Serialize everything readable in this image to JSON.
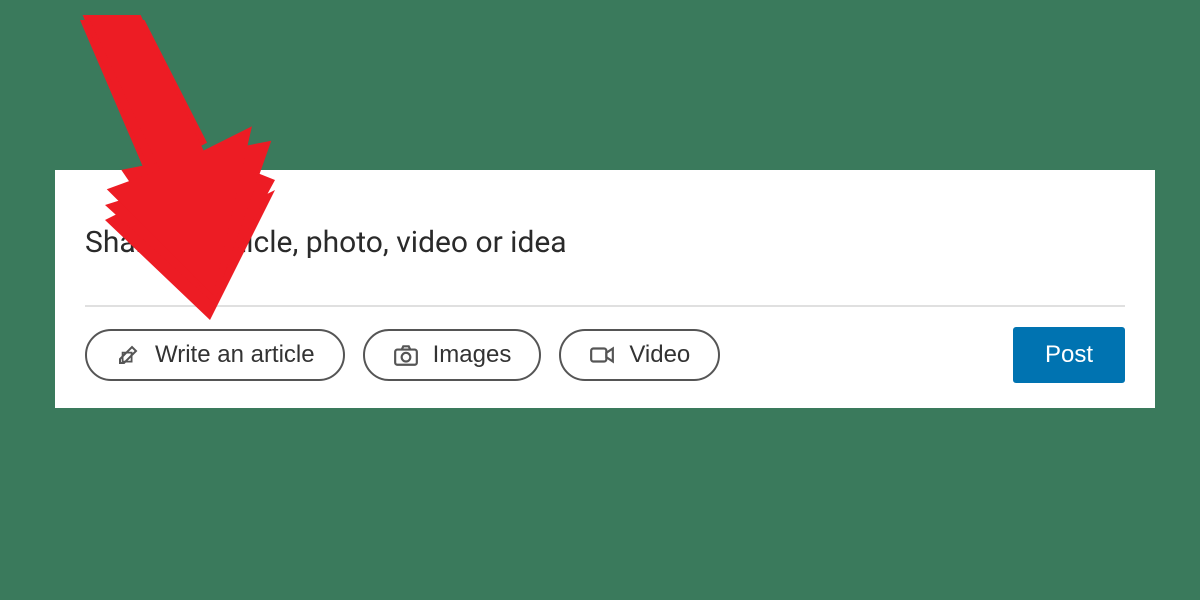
{
  "composer": {
    "placeholder": "Share an article, photo, video or idea",
    "actions": {
      "write_label": "Write an article",
      "images_label": "Images",
      "video_label": "Video",
      "post_label": "Post"
    }
  },
  "colors": {
    "accent": "#0073b1",
    "annotation": "#ed1c24"
  }
}
